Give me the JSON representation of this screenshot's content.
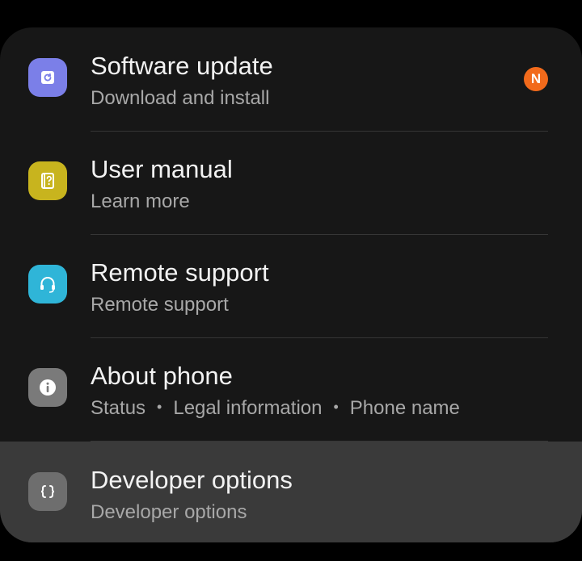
{
  "settings_list": {
    "items": [
      {
        "title": "Software update",
        "subtitle": "Download and install",
        "icon": "software-update-icon",
        "icon_color": "#7b7fe8",
        "badge": "N",
        "badge_color": "#f26a1b"
      },
      {
        "title": "User manual",
        "subtitle": "Learn more",
        "icon": "user-manual-icon",
        "icon_color": "#c8b41e"
      },
      {
        "title": "Remote support",
        "subtitle": "Remote support",
        "icon": "headset-icon",
        "icon_color": "#2fb5d8"
      },
      {
        "title": "About phone",
        "subtitle_parts": [
          "Status",
          "Legal information",
          "Phone name"
        ],
        "subtitle_separator": "•",
        "icon": "info-icon",
        "icon_color": "#7a7a7a"
      },
      {
        "title": "Developer options",
        "subtitle": "Developer options",
        "icon": "braces-icon",
        "icon_color": "#6e6e6e",
        "highlighted": true
      }
    ]
  },
  "colors": {
    "background": "#000000",
    "card": "#171717",
    "highlight": "#3a3a3a",
    "title_text": "#f2f2f2",
    "subtitle_text": "#a8a8a8"
  }
}
